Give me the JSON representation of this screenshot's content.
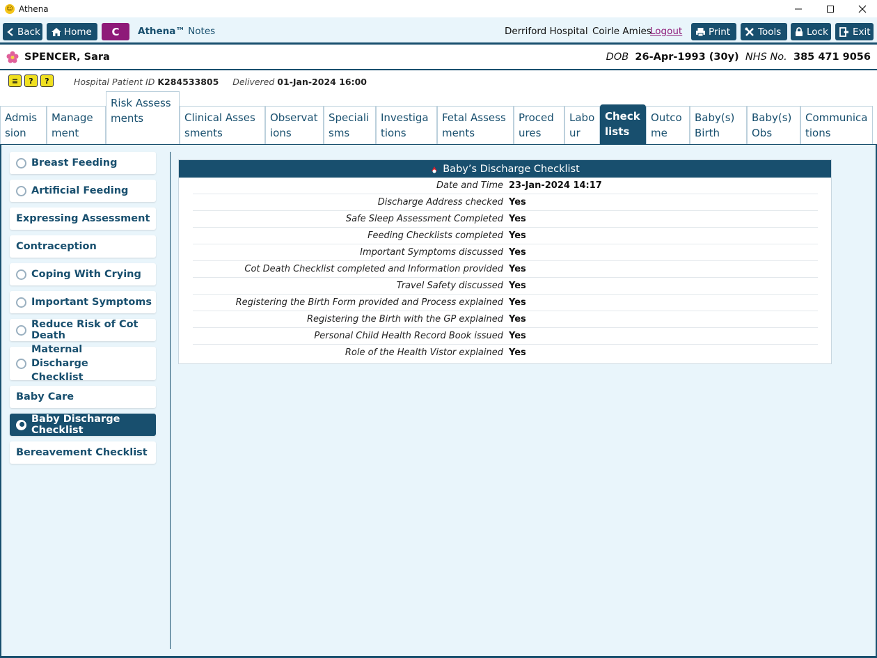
{
  "window": {
    "title": "Athena",
    "minimize": "—",
    "maximize": "☐",
    "close": "✕"
  },
  "toolbar": {
    "back": "Back",
    "home": "Home",
    "c_button": "C",
    "brand_name": "Athena™",
    "brand_sub": " Notes",
    "hospital": "Derriford Hospital",
    "user": "Coirle Amies",
    "logout": "Logout",
    "print": "Print",
    "tools": "Tools",
    "lock": "Lock",
    "exit": "Exit"
  },
  "patient": {
    "name": "SPENCER, Sara",
    "dob_label": "DOB",
    "dob": "26-Apr-1993 (30y)",
    "nhs_label": "NHS No.",
    "nhs": "385 471 9056",
    "hospital_id_label": "Hospital Patient ID",
    "hospital_id": "K284533805",
    "delivered_label": "Delivered",
    "delivered": "01-Jan-2024 16:00"
  },
  "tabs": [
    "Admission",
    "Management",
    "Risk Assessments",
    "Clinical Assessments",
    "Observations",
    "Specialisms",
    "Investigations",
    "Fetal Assessments",
    "Procedures",
    "Labour",
    "Checklists",
    "Outcome",
    "Baby(s) Birth",
    "Baby(s) Obs",
    "Communications"
  ],
  "active_tab": "Checklists",
  "sidebar": [
    {
      "label": "Breast Feeding",
      "radio": true
    },
    {
      "label": "Artificial Feeding",
      "radio": true
    },
    {
      "label": "Expressing Assessment",
      "radio": false
    },
    {
      "label": "Contraception",
      "radio": false
    },
    {
      "label": "Coping With Crying",
      "radio": true
    },
    {
      "label": "Important Symptoms",
      "radio": true
    },
    {
      "label": "Reduce Risk of Cot Death",
      "radio": true
    },
    {
      "label": "Maternal Discharge Checklist",
      "radio": true
    },
    {
      "label": "Baby Care",
      "radio": false
    },
    {
      "label": "Baby Discharge Checklist",
      "radio": true,
      "active": true
    },
    {
      "label": "Bereavement Checklist",
      "radio": false
    }
  ],
  "checklist": {
    "title": "Baby’s Discharge Checklist",
    "rows": [
      {
        "label": "Date and Time",
        "value": "23-Jan-2024 14:17"
      },
      {
        "label": "Discharge Address checked",
        "value": "Yes"
      },
      {
        "label": "Safe Sleep Assessment Completed ",
        "value": "Yes"
      },
      {
        "label": "Feeding Checklists completed",
        "value": "Yes"
      },
      {
        "label": "Important Symptoms discussed",
        "value": "Yes"
      },
      {
        "label": "Cot Death Checklist completed and Information provided",
        "value": "Yes"
      },
      {
        "label": "Travel Safety discussed",
        "value": "Yes"
      },
      {
        "label": "Registering the Birth Form provided and Process explained",
        "value": "Yes"
      },
      {
        "label": "Registering the Birth with the GP explained",
        "value": "Yes"
      },
      {
        "label": "Personal Child Health Record Book issued",
        "value": "Yes"
      },
      {
        "label": "Role of the Health Vistor explained",
        "value": "Yes"
      }
    ]
  },
  "colors": {
    "primary": "#184f6e",
    "accent": "#8e1a79",
    "background": "#e9f5fb"
  }
}
